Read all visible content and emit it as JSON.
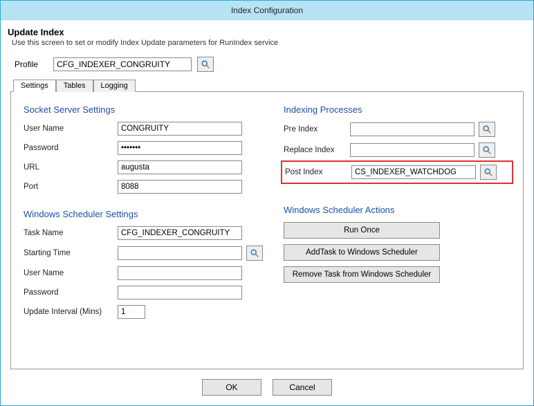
{
  "window": {
    "title": "Index Configuration"
  },
  "header": {
    "title": "Update Index",
    "subtitle": "Use this screen to set or modify Index Update parameters for RunIndex service"
  },
  "profile": {
    "label": "Profile",
    "value": "CFG_INDEXER_CONGRUITY"
  },
  "tabs": {
    "settings": "Settings",
    "tables": "Tables",
    "logging": "Logging"
  },
  "socket": {
    "heading": "Socket Server Settings",
    "username_label": "User Name",
    "username_value": "CONGRUITY",
    "password_label": "Password",
    "password_value": "•••••••",
    "url_label": "URL",
    "url_value": "augusta",
    "port_label": "Port",
    "port_value": "8088"
  },
  "sched": {
    "heading": "Windows Scheduler Settings",
    "task_label": "Task Name",
    "task_value": "CFG_INDEXER_CONGRUITY",
    "start_label": "Starting Time",
    "start_value": "",
    "user_label": "User Name",
    "user_value": "",
    "pass_label": "Password",
    "pass_value": "",
    "interval_label": "Update Interval (Mins)",
    "interval_value": "1"
  },
  "indexing": {
    "heading": "Indexing Processes",
    "pre_label": "Pre Index",
    "pre_value": "",
    "replace_label": "Replace Index",
    "replace_value": "",
    "post_label": "Post Index",
    "post_value": "CS_INDEXER_WATCHDOG"
  },
  "actions": {
    "heading": "Windows Scheduler Actions",
    "run_once": "Run Once",
    "add_task": "AddTask to Windows Scheduler",
    "remove_task": "Remove Task from Windows Scheduler"
  },
  "footer": {
    "ok": "OK",
    "cancel": "Cancel"
  }
}
